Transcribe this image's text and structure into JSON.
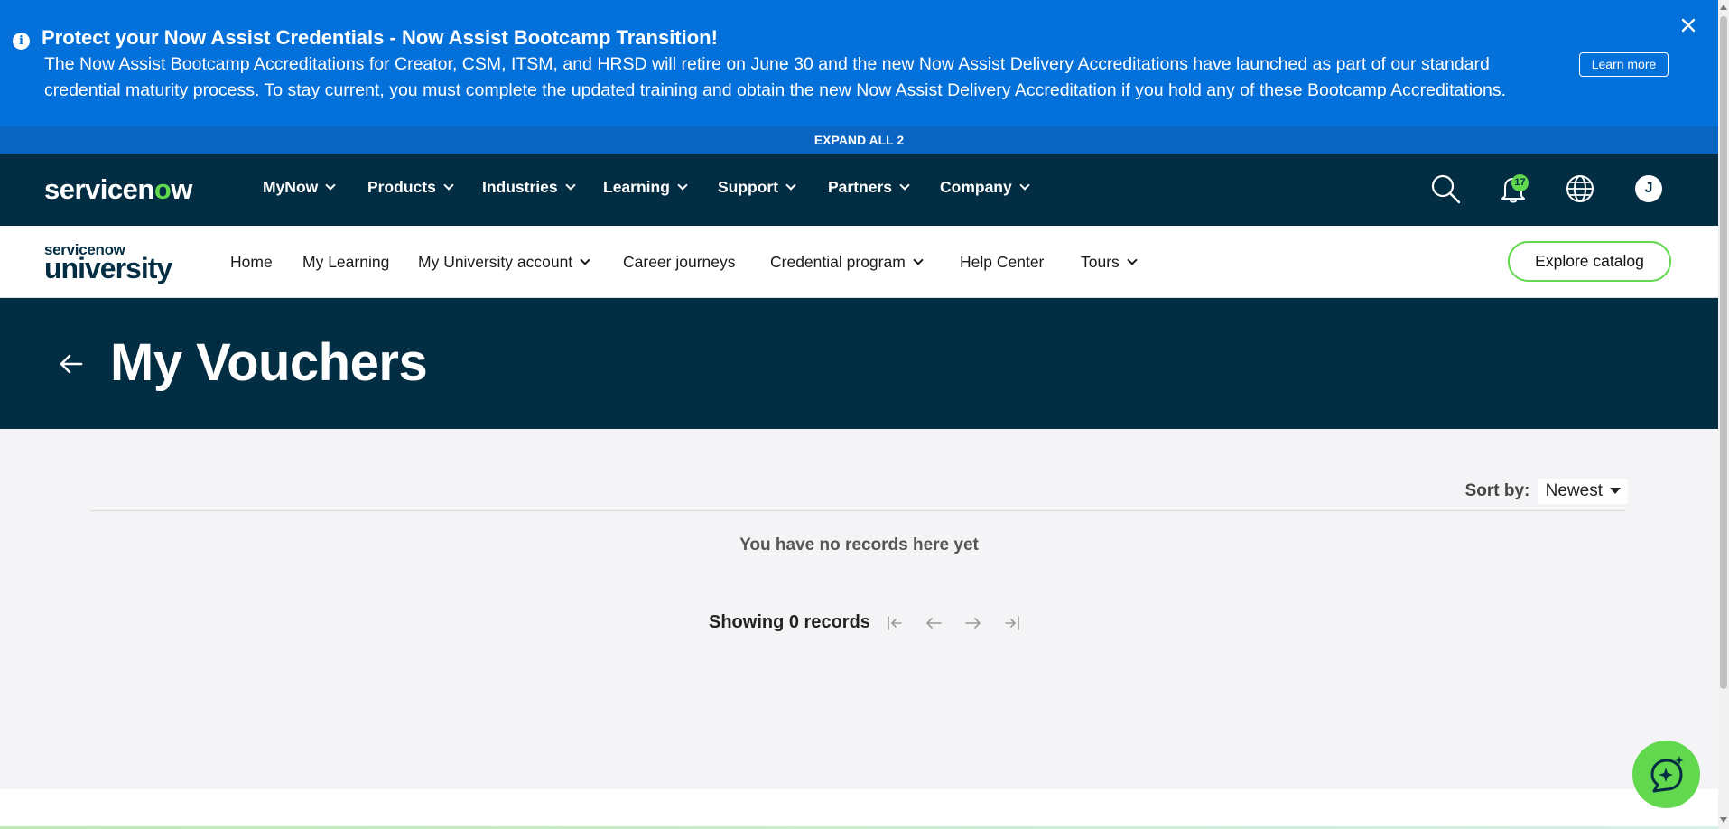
{
  "banner": {
    "title": "Protect your Now Assist Credentials - Now Assist Bootcamp Transition!",
    "body": "The Now Assist Bootcamp Accreditations for Creator, CSM, ITSM, and HRSD will retire on June 30 and the new Now Assist Delivery Accreditations have launched as part of our standard credential maturity process. To stay current, you must complete the updated training and obtain the new Now Assist Delivery Accreditation if you hold any of these Bootcamp Accreditations.",
    "learn_more": "Learn more",
    "info_icon": "i",
    "expand_all": "EXPAND ALL 2"
  },
  "topnav": {
    "brand_prefix": "servicen",
    "brand_o": "o",
    "brand_suffix": "w",
    "items": [
      "MyNow",
      "Products",
      "Industries",
      "Learning",
      "Support",
      "Partners",
      "Company"
    ],
    "notification_count": "17",
    "avatar_initial": "J"
  },
  "subnav": {
    "logo_line1": "servicenow",
    "logo_line2": "university",
    "items": [
      "Home",
      "My Learning",
      "My University account",
      "Career journeys",
      "Credential program",
      "Help Center",
      "Tours"
    ],
    "explore_label": "Explore catalog"
  },
  "hero": {
    "title": "My Vouchers"
  },
  "main": {
    "sort_label": "Sort by:",
    "sort_value": "Newest",
    "empty_message": "You have no records here yet",
    "showing": "Showing 0 records"
  },
  "colors": {
    "banner": "#0371d9",
    "navy": "#032d42",
    "accent_green": "#62d84e",
    "page_bg": "#f4f4f6"
  },
  "icons": [
    "info-icon",
    "close-icon",
    "search-icon",
    "bell-icon",
    "globe-icon",
    "back-arrow-icon",
    "first-page-icon",
    "prev-page-icon",
    "next-page-icon",
    "last-page-icon",
    "ai-chat-icon"
  ]
}
